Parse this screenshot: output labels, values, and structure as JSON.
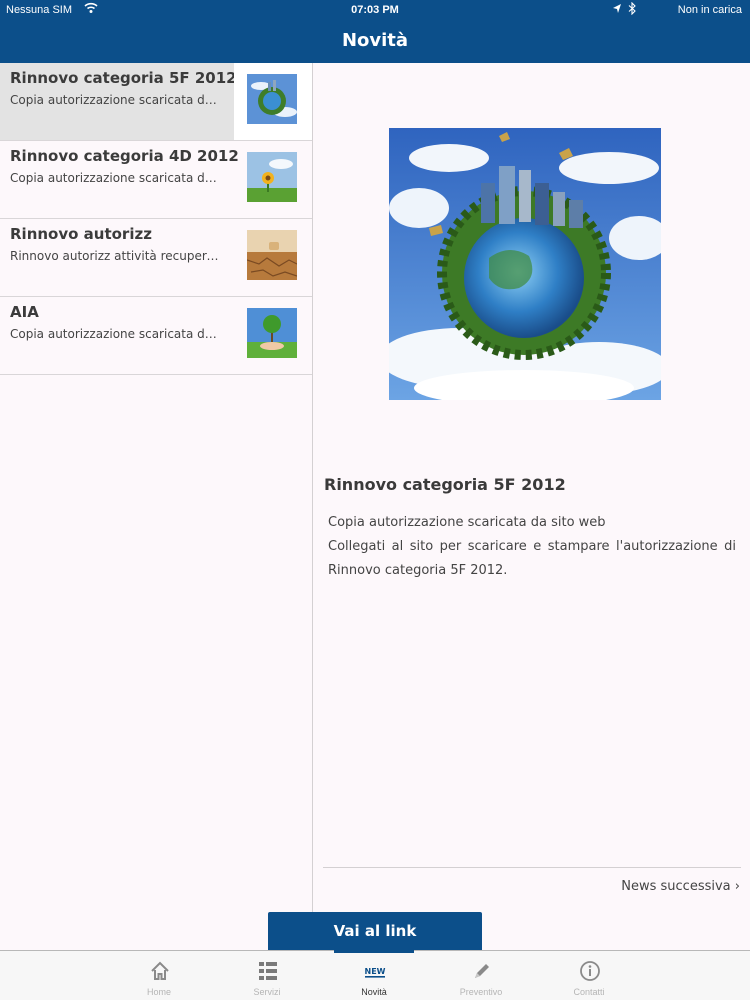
{
  "status_bar": {
    "carrier": "Nessuna SIM",
    "time": "07:03 PM",
    "battery": "Non in carica"
  },
  "nav": {
    "title": "Novità"
  },
  "list": [
    {
      "title": "Rinnovo categoria 5F 2012",
      "subtitle": "Copia autorizzazione scaricata da sito web",
      "thumb": "globe-city",
      "selected": true
    },
    {
      "title": "Rinnovo categoria 4D 2012",
      "subtitle": "Copia autorizzazione scaricata da sito web",
      "thumb": "sunflower-field"
    },
    {
      "title": "Rinnovo autorizz",
      "subtitle": "Rinnovo autorizz attività recupero rifiuti",
      "thumb": "dry-soil"
    },
    {
      "title": "AIA",
      "subtitle": "Copia autorizzazione scaricata da sito web",
      "thumb": "tree-in-hand"
    }
  ],
  "detail": {
    "title": "Rinnovo categoria 5F 2012",
    "line1": "Copia autorizzazione scaricata da sito web",
    "line2": "Collegati al sito per scaricare e stampare l'autorizzazione di Rinnovo categoria 5F 2012.",
    "next_label": "News successiva",
    "cta_label": "Vai al link"
  },
  "tabs": [
    {
      "label": "Home",
      "icon": "home-icon"
    },
    {
      "label": "Servizi",
      "icon": "list-icon"
    },
    {
      "label": "Novità",
      "icon": "new-icon",
      "active": true
    },
    {
      "label": "Preventivo",
      "icon": "pencil-icon"
    },
    {
      "label": "Contatti",
      "icon": "info-icon"
    }
  ],
  "colors": {
    "primary": "#0c4f8a",
    "selected_row": "#e3e3e3",
    "background": "#fdf8fb"
  }
}
